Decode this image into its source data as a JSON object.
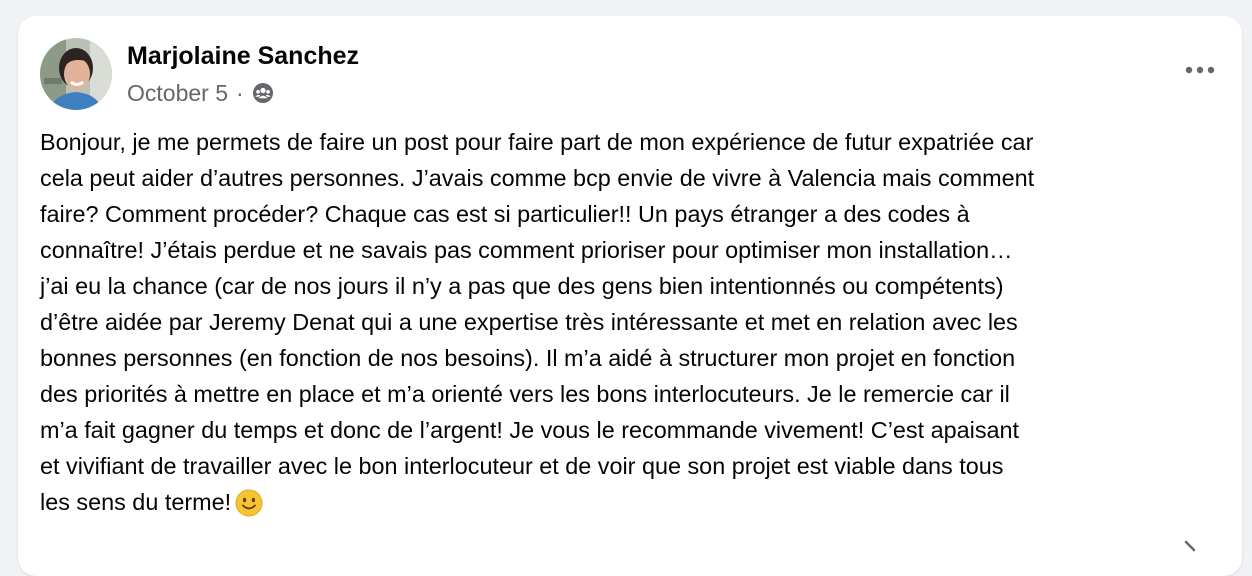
{
  "post": {
    "author": {
      "name": "Marjolaine Sanchez"
    },
    "meta": {
      "date": "October 5",
      "separator": "·",
      "audience_icon": "group-audience-icon"
    },
    "more_icon": "more-options-icon",
    "text_lines": [
      "Bonjour, je me permets de faire un post pour faire part de mon expérience de futur expatriée car",
      "cela peut aider d’autres personnes. J’avais comme bcp envie de vivre à Valencia mais comment",
      "faire? Comment procéder? Chaque cas est si particulier!! Un pays étranger a des codes à",
      "connaître! J’étais perdue et ne savais pas comment prioriser pour optimiser mon installation…",
      "j’ai eu la chance (car de nos jours il n’y a pas que des gens bien intentionnés ou compétents)",
      "d’être aidée par Jeremy Denat qui a une expertise très intéressante et met en relation avec les",
      "bonnes personnes (en fonction de nos besoins). Il m’a aidé à structurer mon projet en fonction",
      "des priorités à mettre en place et m’a orienté vers les bons interlocuteurs. Je le remercie car il",
      "m’a fait gagner du temps et donc de l’argent! Je vous le recommande vivement! C’est apaisant",
      "et vivifiant de travailler avec le bon interlocuteur et de voir que son projet est viable dans tous",
      "les sens du terme!"
    ],
    "emoji_icon": "smiling-face-emoji-icon"
  },
  "colors": {
    "page_background": "#f0f2f5",
    "card_background": "#ffffff",
    "text_primary": "#050505",
    "text_secondary": "#65676b",
    "emoji_yellow": "#f7c331"
  }
}
